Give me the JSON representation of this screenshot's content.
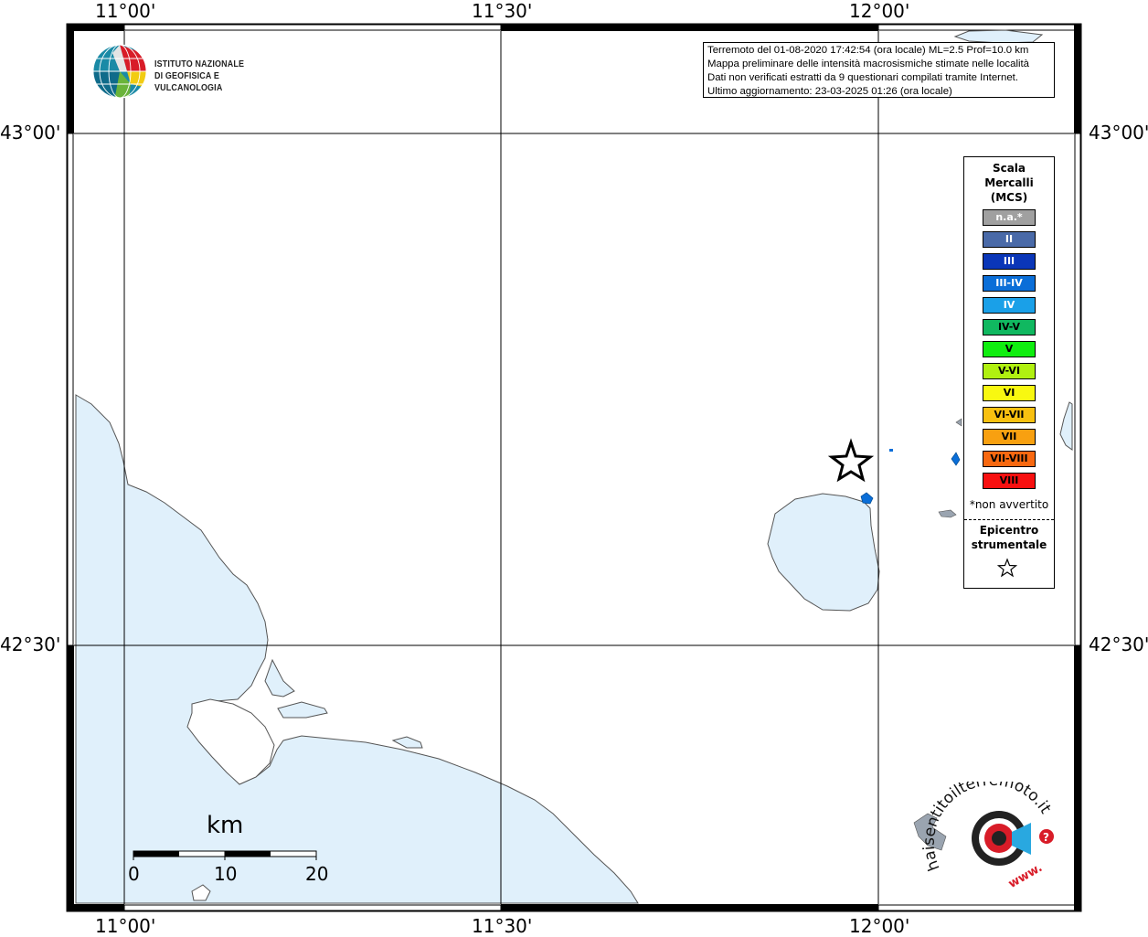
{
  "info_box": {
    "line1": "Terremoto del 01-08-2020 17:42:54 (ora locale) ML=2.5 Prof=10.0 km",
    "line2": "Mappa preliminare delle intensità macrosismiche stimate nelle località",
    "line3": "Dati non verificati estratti da 9 questionari compilati tramite Internet.",
    "line4": "Ultimo aggiornamento: 23-03-2025 01:26 (ora locale)"
  },
  "ingv_logo": {
    "line1": "ISTITUTO NAZIONALE",
    "line2": "DI GEOFISICA E VULCANOLOGIA"
  },
  "axes": {
    "top_labels": [
      "11°00'",
      "11°30'",
      "12°00'"
    ],
    "bottom_labels": [
      "11°00'",
      "11°30'",
      "12°00'"
    ],
    "left_labels": [
      "43°00'",
      "42°30'"
    ],
    "right_labels": [
      "43°00'",
      "42°30'"
    ]
  },
  "legend": {
    "title_line1": "Scala",
    "title_line2": "Mercalli",
    "title_line3": "(MCS)",
    "items": [
      {
        "label": "n.a.*",
        "color": "#a0a0a0",
        "text_color": "#ffffff"
      },
      {
        "label": "II",
        "color": "#4a6aa8",
        "text_color": "#ffffff"
      },
      {
        "label": "III",
        "color": "#0a36b8",
        "text_color": "#ffffff"
      },
      {
        "label": "III-IV",
        "color": "#0a6ed8",
        "text_color": "#ffffff"
      },
      {
        "label": "IV",
        "color": "#1aa0e8",
        "text_color": "#ffffff"
      },
      {
        "label": "IV-V",
        "color": "#10b860",
        "text_color": "#000000"
      },
      {
        "label": "V",
        "color": "#10ee10",
        "text_color": "#000000"
      },
      {
        "label": "V-VI",
        "color": "#b0f010",
        "text_color": "#000000"
      },
      {
        "label": "VI",
        "color": "#f8f810",
        "text_color": "#000000"
      },
      {
        "label": "VI-VII",
        "color": "#f8c010",
        "text_color": "#000000"
      },
      {
        "label": "VII",
        "color": "#f8a010",
        "text_color": "#000000"
      },
      {
        "label": "VII-VIII",
        "color": "#f86810",
        "text_color": "#000000"
      },
      {
        "label": "VIII",
        "color": "#f81010",
        "text_color": "#000000"
      }
    ],
    "note": "*non avvertito",
    "epicenter_line1": "Epicentro",
    "epicenter_line2": "strumentale"
  },
  "scale_bar": {
    "title": "km",
    "labels": [
      "0",
      "10",
      "20"
    ]
  },
  "hst_logo": {
    "text": "haisentitoilterremoto.it",
    "prefix": "www."
  },
  "colors": {
    "water": "#e0f0fb",
    "coast": "#555555",
    "intensity_iii_iv": "#0a6ed8"
  }
}
